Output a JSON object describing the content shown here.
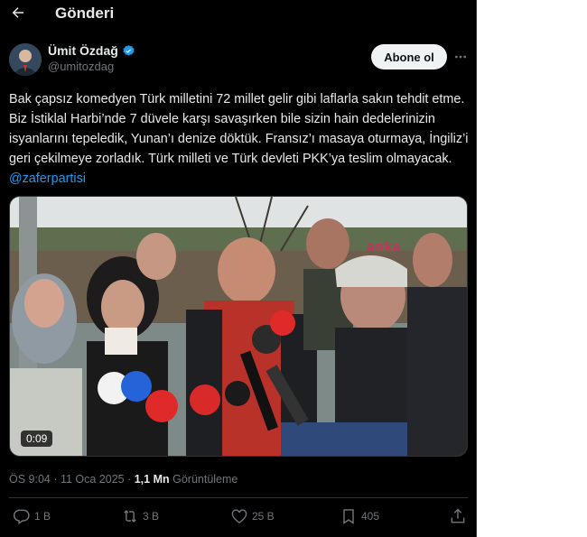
{
  "header": {
    "title": "Gönderi"
  },
  "author": {
    "name": "Ümit Özdağ",
    "handle": "@umitozdag"
  },
  "follow_label": "Abone ol",
  "tweet": {
    "text": "Bak çapsız komedyen Türk milletini 72 millet gelir gibi laflarla sakın tehdit etme. Biz İstiklal Harbi’nde 7 düvele karşı savaşırken bile sizin hain dedelerinizin isyanlarını tepeledik, Yunan’ı denize döktük. Fransız’ı masaya oturmaya, İngiliz’i geri çekilmeye zorladık. Türk milleti ve Türk devleti PKK’ya teslim olmayacak.",
    "mention": "@zaferpartisi"
  },
  "media": {
    "duration": "0:09",
    "watermark": "anka"
  },
  "meta": {
    "time": "ÖS 9:04 · 11 Oca 2025 · ",
    "views": "1,1 Mn",
    "views_label": " Görüntüleme"
  },
  "actions": {
    "replies": "1 B",
    "reposts": "3 B",
    "likes": "25 B",
    "bookmarks": "405"
  },
  "colors": {
    "accent": "#1d9bf0",
    "background": "#000000",
    "text": "#e7e9ea",
    "muted": "#71767b"
  },
  "icons": [
    "back-arrow-icon",
    "verified-badge-icon",
    "more-icon",
    "reply-icon",
    "repost-icon",
    "like-icon",
    "bookmark-icon",
    "share-icon"
  ]
}
